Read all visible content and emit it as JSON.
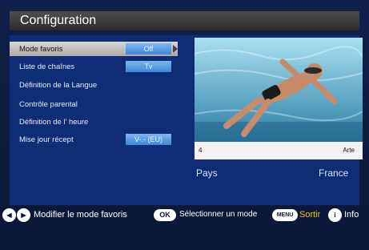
{
  "title": "Configuration",
  "menu": {
    "items": [
      {
        "label": "Mode favoris",
        "value": "Off"
      },
      {
        "label": "Liste de chaînes",
        "value": "Tv"
      },
      {
        "label": "Définition de la Langue"
      },
      {
        "label": "Contrôle parental"
      },
      {
        "label": "Définition de l' heure"
      },
      {
        "label": "Mise jour récept",
        "value": "V-.- (EU)"
      }
    ]
  },
  "preview": {
    "channel_number": "4",
    "channel_name": "Arte"
  },
  "country": {
    "label": "Pays",
    "value": "France"
  },
  "help": {
    "nav_text": "Modifier le mode favoris",
    "ok_key": "OK",
    "ok_text": "Sélectionner un mode",
    "menu_key": "MENU",
    "menu_text": "Sortir",
    "info_key": "i",
    "info_text": "Info",
    "menu_text_color": "#f2c600"
  }
}
